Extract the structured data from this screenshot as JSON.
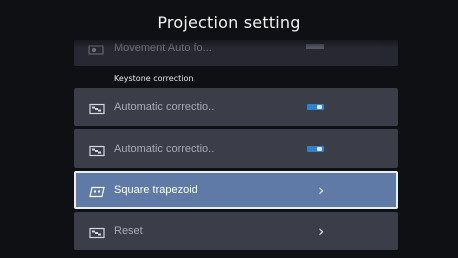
{
  "header": {
    "title": "Projection setting"
  },
  "faded_item": {
    "label": "Movement Auto fo...",
    "icon": "projector-icon",
    "value": "ON"
  },
  "section": {
    "label": "Keystone correction"
  },
  "items": [
    {
      "label": "Automatic correctio..",
      "icon": "projector-icon",
      "control": "toggle",
      "state": "on",
      "toggle_color": "#2f84c8"
    },
    {
      "label": "Automatic correctio..",
      "icon": "projector-icon",
      "control": "toggle",
      "state": "on",
      "toggle_color": "#2f84c8"
    },
    {
      "label": "Square trapezoid",
      "icon": "trapezoid-icon",
      "control": "chevron",
      "chevron": "›",
      "selected": true
    },
    {
      "label": "Reset",
      "icon": "projector-icon",
      "control": "chevron",
      "chevron": "›"
    }
  ],
  "colors": {
    "background": "#0f1014",
    "row": "#3b3d49",
    "selected_row": "#5f7aa6",
    "selected_border": "#e9eef6"
  }
}
